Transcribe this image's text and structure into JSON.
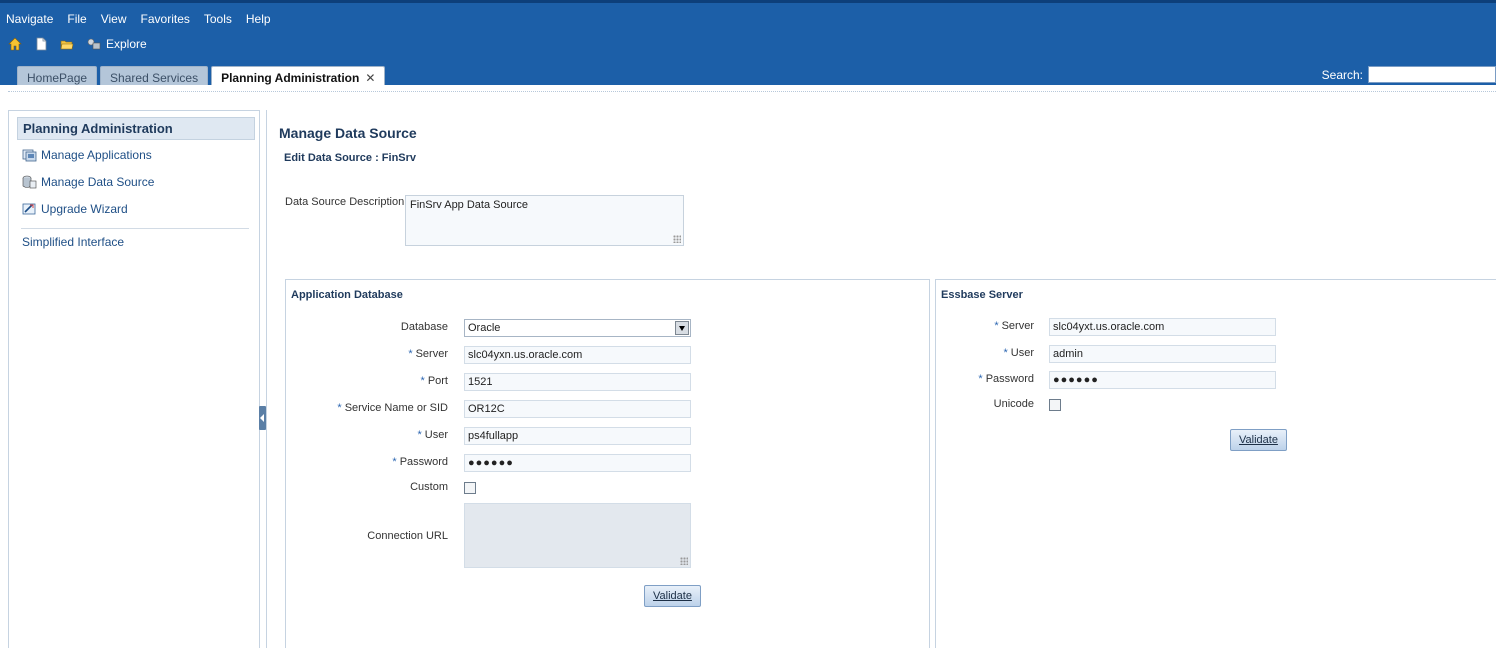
{
  "menu": [
    "Navigate",
    "File",
    "View",
    "Favorites",
    "Tools",
    "Help"
  ],
  "toolbar": {
    "explore_label": "Explore"
  },
  "tabs": [
    {
      "label": "HomePage",
      "active": false
    },
    {
      "label": "Shared Services",
      "active": false
    },
    {
      "label": "Planning Administration",
      "active": true,
      "close": "✕"
    }
  ],
  "search": {
    "label": "Search:",
    "value": ""
  },
  "sidebar": {
    "title": "Planning Administration",
    "items": [
      {
        "label": "Manage Applications",
        "icon": "manage-applications-icon"
      },
      {
        "label": "Manage Data Source",
        "icon": "manage-data-source-icon"
      },
      {
        "label": "Upgrade Wizard",
        "icon": "upgrade-wizard-icon"
      }
    ],
    "simplified": "Simplified Interface"
  },
  "main": {
    "title": "Manage Data Source",
    "subtitle": "Edit Data Source : FinSrv",
    "description_label": "Data Source Description",
    "description_value": "FinSrv App Data Source"
  },
  "app_db": {
    "title": "Application Database",
    "database_label": "Database",
    "database_value": "Oracle",
    "server_label": "Server",
    "server_value": "slc04yxn.us.oracle.com",
    "port_label": "Port",
    "port_value": "1521",
    "sid_label": "Service Name or SID",
    "sid_value": "OR12C",
    "user_label": "User",
    "user_value": "ps4fullapp",
    "password_label": "Password",
    "password_value": "●●●●●●",
    "custom_label": "Custom",
    "conn_url_label": "Connection URL",
    "validate_label": "Validate"
  },
  "essbase": {
    "title": "Essbase Server",
    "server_label": "Server",
    "server_value": "slc04yxt.us.oracle.com",
    "user_label": "User",
    "user_value": "admin",
    "password_label": "Password",
    "password_value": "●●●●●●",
    "unicode_label": "Unicode",
    "validate_label": "Validate"
  },
  "required_marker": "*",
  "colors": {
    "header_blue": "#1c5fa8",
    "link_blue": "#1f4f86",
    "title_navy": "#1f3a5c"
  }
}
